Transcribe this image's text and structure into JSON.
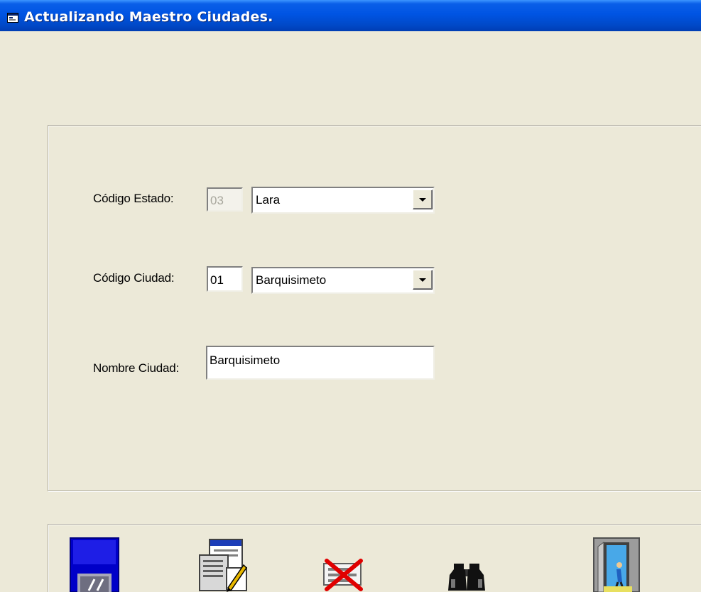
{
  "window": {
    "title": "Actualizando Maestro Ciudades.",
    "icon": "form-window-icon"
  },
  "form": {
    "estado": {
      "label": "Código Estado:",
      "code": "03",
      "code_disabled": true,
      "selected": "Lara"
    },
    "ciudad": {
      "label": "Código Ciudad:",
      "code": "01",
      "selected": "Barquisimeto"
    },
    "nombre": {
      "label": "Nombre Ciudad:",
      "value": "Barquisimeto"
    }
  },
  "toolbar": {
    "buttons": [
      {
        "icon": "save-disk-icon",
        "action": "save"
      },
      {
        "icon": "edit-form-icon",
        "action": "edit"
      },
      {
        "icon": "delete-icon",
        "action": "delete"
      },
      {
        "icon": "binoculars-icon",
        "action": "search"
      },
      {
        "icon": "exit-door-icon",
        "action": "exit"
      }
    ]
  },
  "colors": {
    "titlebar": "#0054E3",
    "window_bg": "#ECE9D8"
  }
}
